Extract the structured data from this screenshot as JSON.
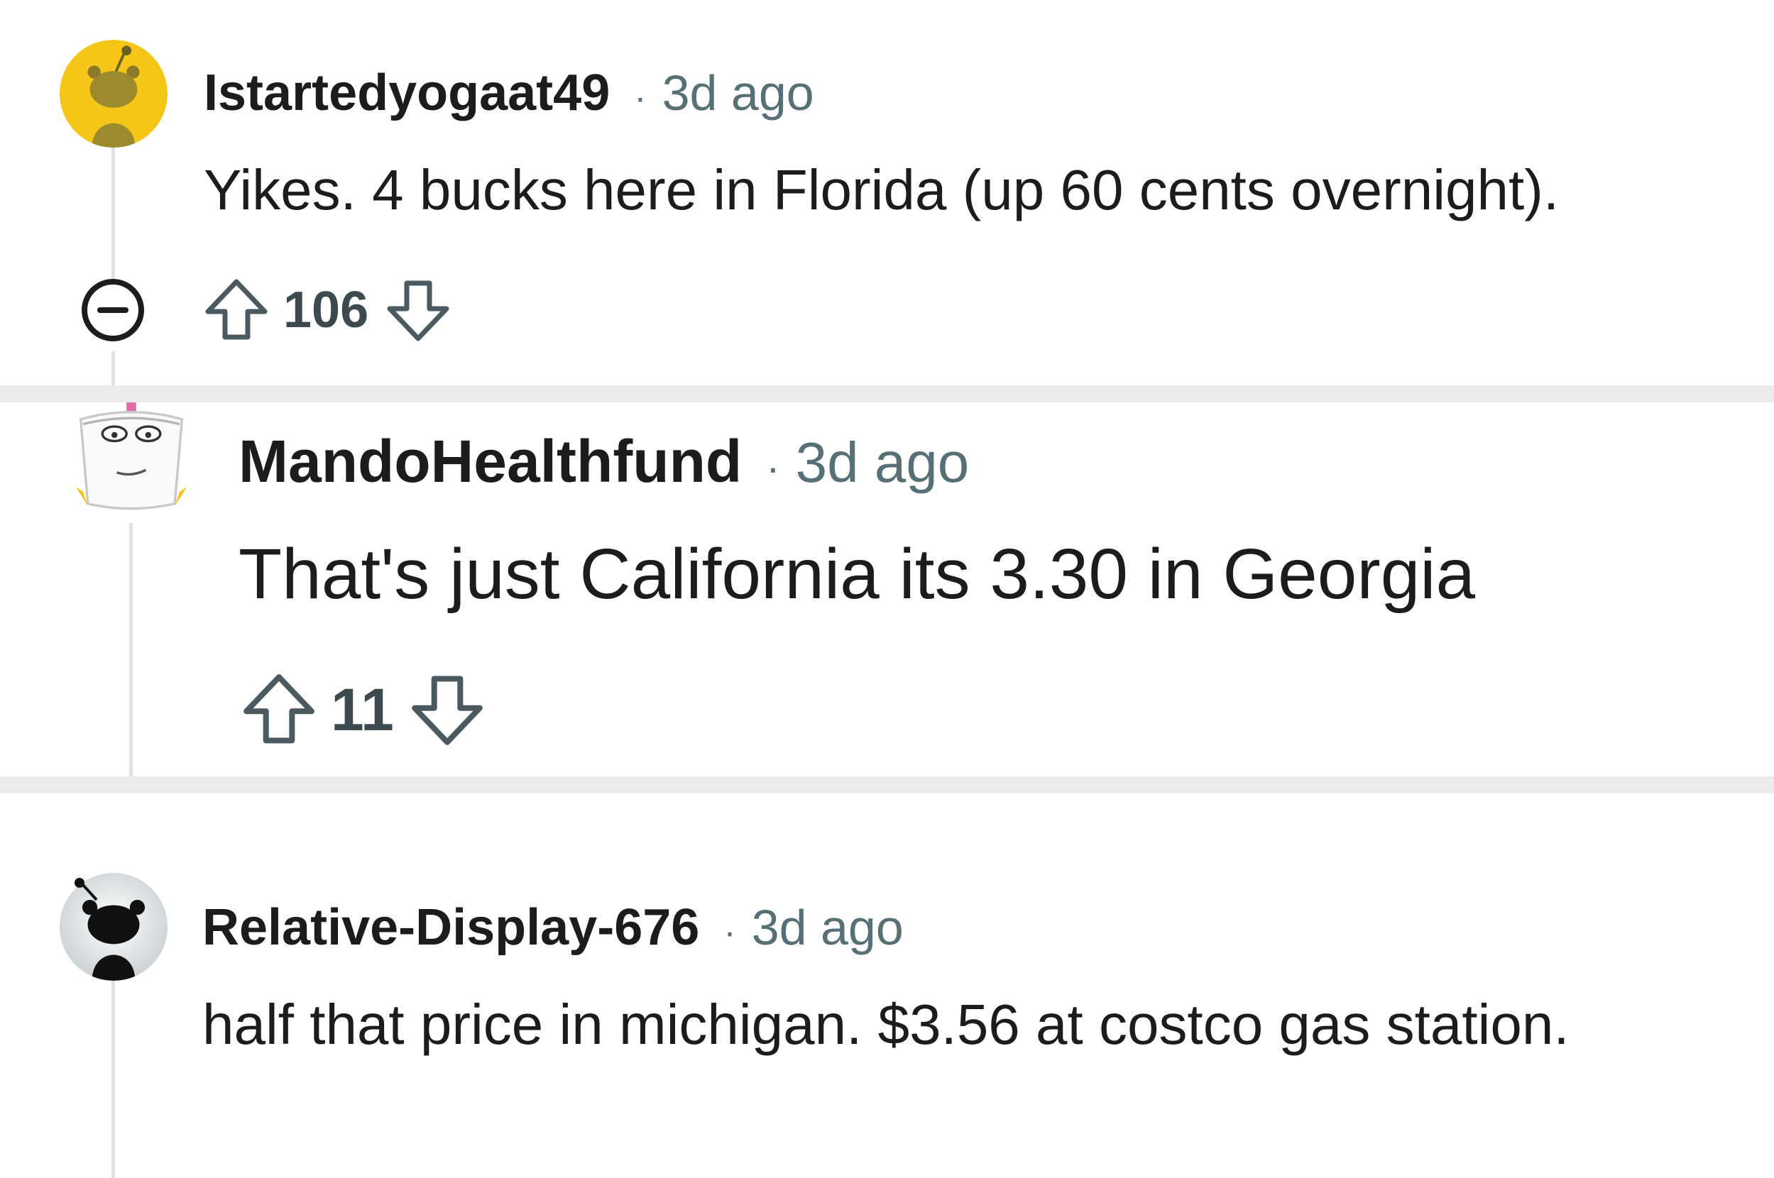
{
  "comments": [
    {
      "username": "Istartedyogaat49",
      "separator": "·",
      "time": "3d ago",
      "body": "Yikes. 4 bucks here in Florida (up 60 cents overnight).",
      "score": "106",
      "avatar_icon": "snoo-avatar-yellow",
      "avatar_color": "#f5c517"
    },
    {
      "username": "MandoHealthfund",
      "separator": "·",
      "time": "3d ago",
      "body": "That's just California its 3.30 in Georgia",
      "score": "11",
      "avatar_icon": "cup-character-avatar"
    },
    {
      "username": "Relative-Display-676",
      "separator": "·",
      "time": "3d ago",
      "body": "half that price in michigan. $3.56 at costco gas station.",
      "avatar_icon": "snoo-avatar-black"
    }
  ],
  "colors": {
    "meta_gray": "#576f76",
    "thread_line": "#e1e1e1",
    "separator_band": "#ececec",
    "vote_icon": "#4b5a60"
  }
}
